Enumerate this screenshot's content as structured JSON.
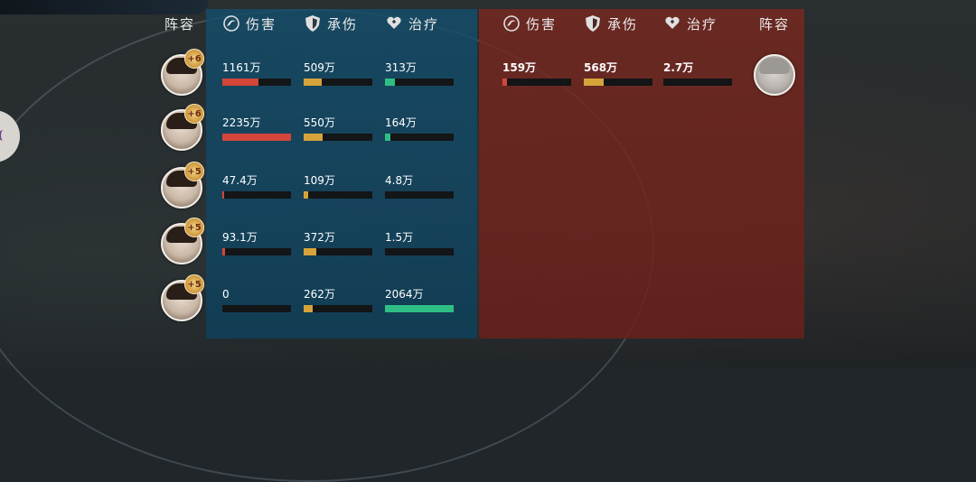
{
  "colors": {
    "ally_panel": "#14506c",
    "enemy_panel": "#782820",
    "damage_bar": "#d4453a",
    "tank_bar": "#d6a33b",
    "heal_bar": "#2fbf85"
  },
  "ally_header": {
    "lineup_label": "阵容",
    "damage_label": "伤害",
    "tank_label": "承伤",
    "heal_label": "治疗"
  },
  "enemy_header": {
    "damage_label": "伤害",
    "tank_label": "承伤",
    "heal_label": "治疗",
    "lineup_label": "阵容"
  },
  "icons": {
    "damage": "swirl-icon",
    "tank": "shield-icon",
    "heal": "heart-hand-icon"
  },
  "ally_units": [
    {
      "badge": "+6",
      "damage": "1161万",
      "damage_ratio": 0.52,
      "tank": "509万",
      "tank_ratio": 0.26,
      "heal": "313万",
      "heal_ratio": 0.15
    },
    {
      "badge": "+6",
      "damage": "2235万",
      "damage_ratio": 1.0,
      "tank": "550万",
      "tank_ratio": 0.28,
      "heal": "164万",
      "heal_ratio": 0.08
    },
    {
      "badge": "+5",
      "damage": "47.4万",
      "damage_ratio": 0.02,
      "tank": "109万",
      "tank_ratio": 0.06,
      "heal": "4.8万",
      "heal_ratio": 0.0
    },
    {
      "badge": "+5",
      "damage": "93.1万",
      "damage_ratio": 0.04,
      "tank": "372万",
      "tank_ratio": 0.19,
      "heal": "1.5万",
      "heal_ratio": 0.0
    },
    {
      "badge": "+5",
      "damage": "0",
      "damage_ratio": 0.0,
      "tank": "262万",
      "tank_ratio": 0.13,
      "heal": "2064万",
      "heal_ratio": 1.0
    }
  ],
  "enemy_units": [
    {
      "damage": "159万",
      "damage_ratio": 0.07,
      "tank": "568万",
      "tank_ratio": 0.29,
      "heal": "2.7万",
      "heal_ratio": 0.0
    }
  ]
}
